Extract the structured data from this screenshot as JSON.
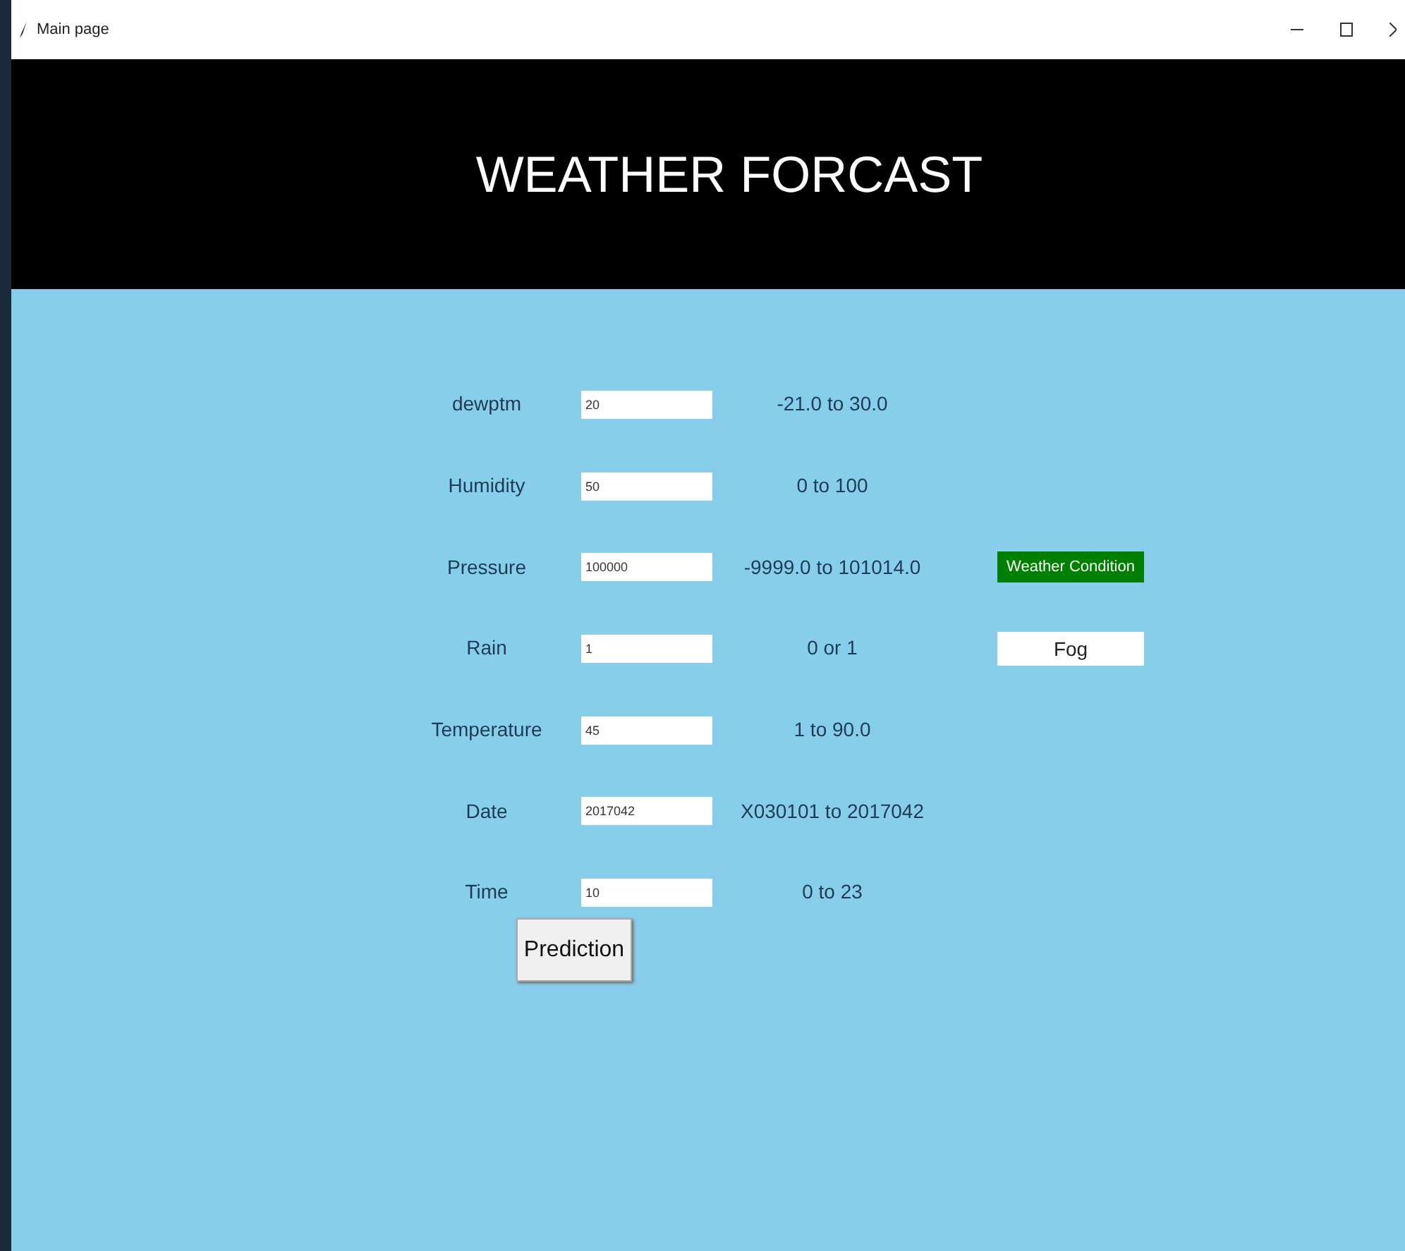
{
  "window": {
    "title": "Main page"
  },
  "header": {
    "title": "WEATHER FORCAST"
  },
  "fields": [
    {
      "label": "dewptm",
      "value": "20",
      "range": "-21.0 to 30.0"
    },
    {
      "label": "Humidity",
      "value": "50",
      "range": "0 to 100"
    },
    {
      "label": "Pressure",
      "value": "100000",
      "range": "-9999.0 to 101014.0"
    },
    {
      "label": "Rain",
      "value": "1",
      "range": "0 or 1"
    },
    {
      "label": "Temperature",
      "value": "45",
      "range": "1 to 90.0"
    },
    {
      "label": "Date",
      "value": "2017042",
      "range": "X030101 to 2017042"
    },
    {
      "label": "Time",
      "value": "10",
      "range": "0 to 23"
    }
  ],
  "result": {
    "heading": "Weather Condition",
    "value": "Fog"
  },
  "buttons": [
    {
      "label": "Prediction"
    }
  ]
}
